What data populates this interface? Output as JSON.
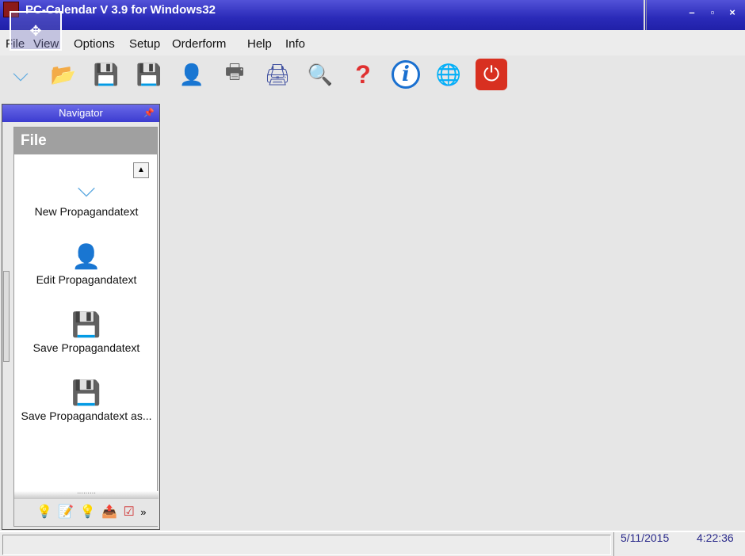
{
  "window": {
    "title": "PC-Calendar V 3.9 for Windows32",
    "minimize": "–",
    "maximize": "▫",
    "close": "×"
  },
  "menu": [
    "File",
    "View",
    "Options",
    "Setup",
    "Orderform",
    "Help",
    "Info"
  ],
  "toolbar": [
    {
      "icon": "new-document-icon",
      "glyph": "⌵",
      "color": "#5aa8e0"
    },
    {
      "icon": "open-folder-icon",
      "glyph": "📂",
      "color": "#e8c050"
    },
    {
      "icon": "save-icon",
      "glyph": "💾",
      "color": "#3c64b4"
    },
    {
      "icon": "save-as-icon",
      "glyph": "💾",
      "color": "#3c64b4"
    },
    {
      "icon": "contact-card-icon",
      "glyph": "👤",
      "color": "#c05020"
    },
    {
      "icon": "print-preview-icon",
      "glyph": "🖶",
      "color": "#606060"
    },
    {
      "icon": "printer-icon",
      "glyph": "🖨",
      "color": "#4050a0"
    },
    {
      "icon": "user-search-icon",
      "glyph": "🔍",
      "color": "#2080c0"
    },
    {
      "icon": "help-icon",
      "glyph": "?",
      "color": "#e03030"
    },
    {
      "icon": "info-icon",
      "glyph": "i",
      "color": "#1a70d0"
    },
    {
      "icon": "globe-icon",
      "glyph": "🌐",
      "color": "#3080d0"
    },
    {
      "icon": "power-icon",
      "glyph": "⏻",
      "color": "#fff"
    }
  ],
  "navigator": {
    "title": "Navigator",
    "section": "File",
    "items": [
      {
        "label": "New Propagandatext",
        "icon": "new-document-icon",
        "glyph": "⌵"
      },
      {
        "label": "Edit Propagandatext",
        "icon": "contact-card-icon",
        "glyph": "👤"
      },
      {
        "label": "Save Propagandatext",
        "icon": "save-icon",
        "glyph": "💾"
      },
      {
        "label": "Save Propagandatext as...",
        "icon": "save-as-icon",
        "glyph": "💾"
      }
    ],
    "bottom_icons": [
      "bulb-icon",
      "edit-notes-icon",
      "bulb-icon",
      "export-icon",
      "checklist-icon"
    ],
    "more": "»"
  },
  "status": {
    "date": "5/11/2015",
    "time": "4:22:36"
  }
}
